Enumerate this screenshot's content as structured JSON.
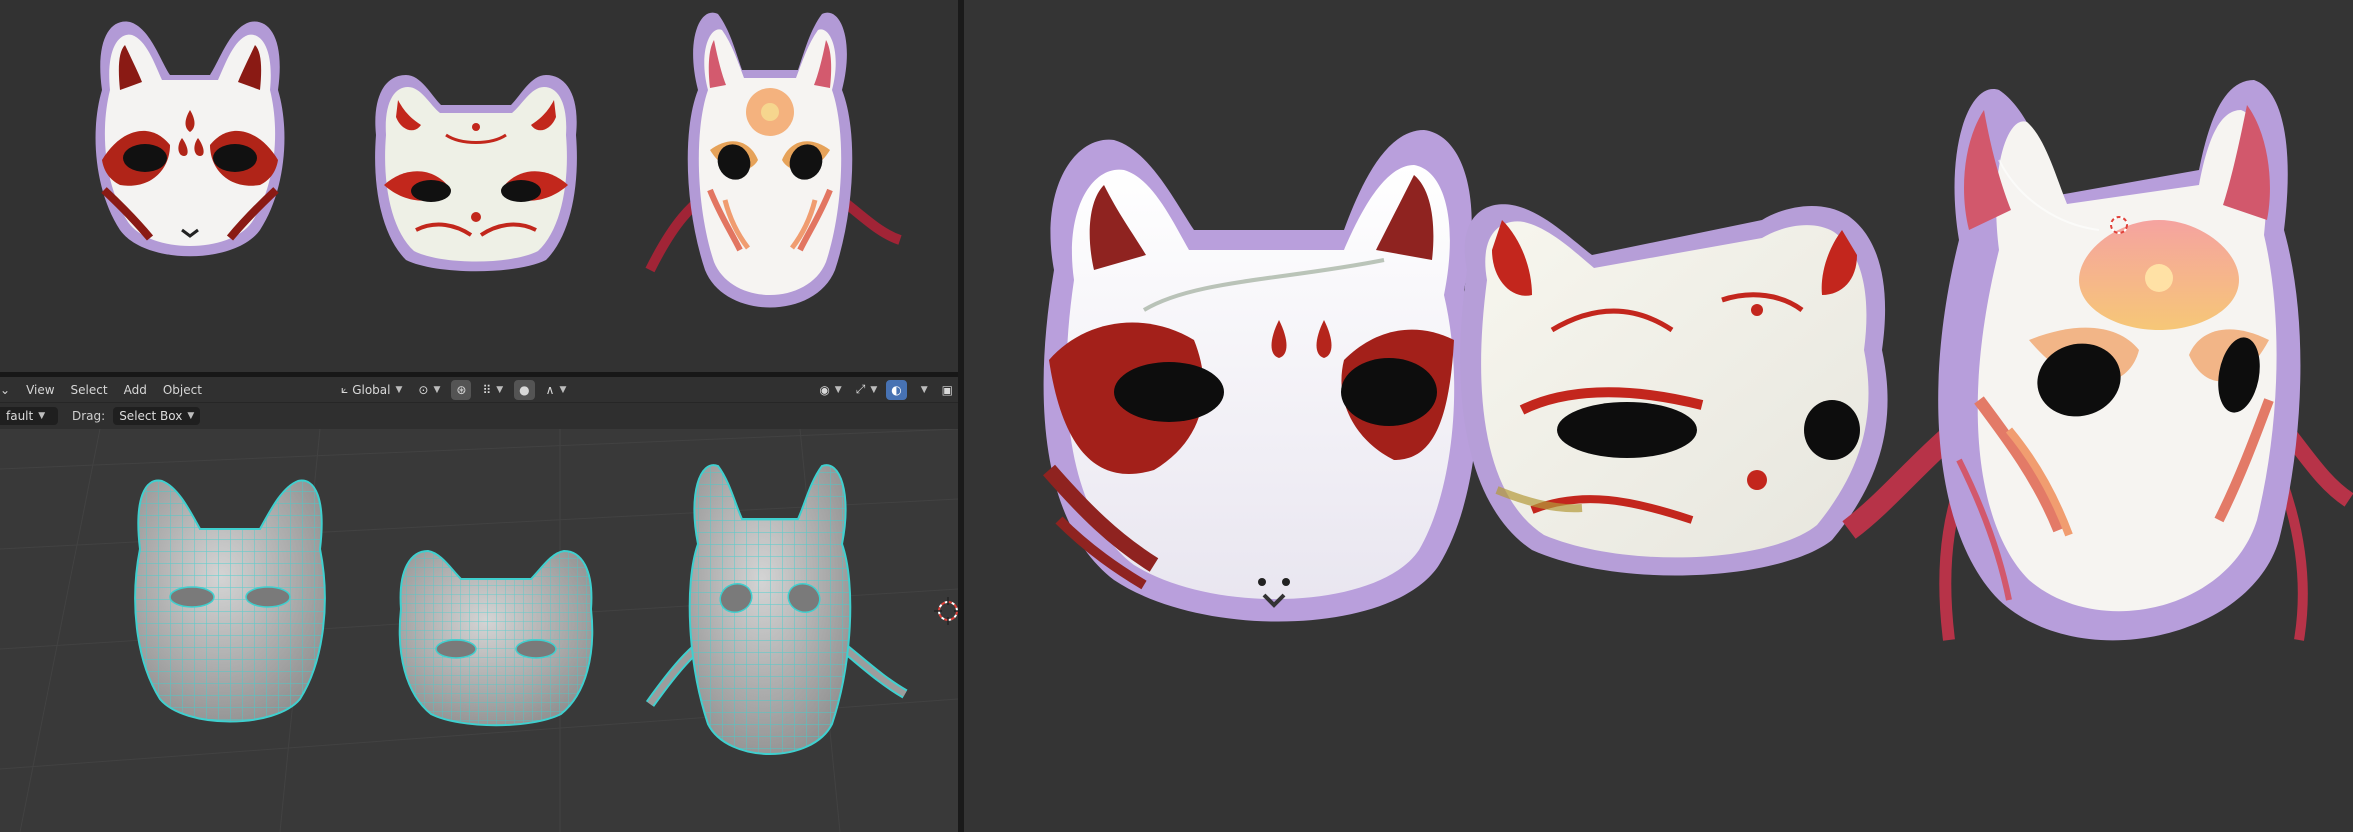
{
  "menu": {
    "mode_partial": "fault",
    "items": [
      "View",
      "Select",
      "Add",
      "Object"
    ]
  },
  "header": {
    "orientation_label": "Global"
  },
  "toolbar": {
    "drag_label": "Drag:",
    "drag_value": "Select Box"
  },
  "colors": {
    "mesh_wire": "#3fd0cf",
    "mask_purple": "#b49ad8",
    "mask_white": "#f4f3f2",
    "mask_red": "#c2271c",
    "dark_red": "#8a1a14",
    "flower_orange": "#f1a56d",
    "active_blue": "#4772b3",
    "background": "#323232"
  },
  "icons": {
    "transform_pivot": "pivot-icon",
    "snap": "snap-icon",
    "proportional": "proportional-icon",
    "visibility": "eye-icon",
    "gizmo": "gizmo-icon",
    "overlay": "overlay-icon",
    "cursor3d": "3d-cursor-icon"
  }
}
